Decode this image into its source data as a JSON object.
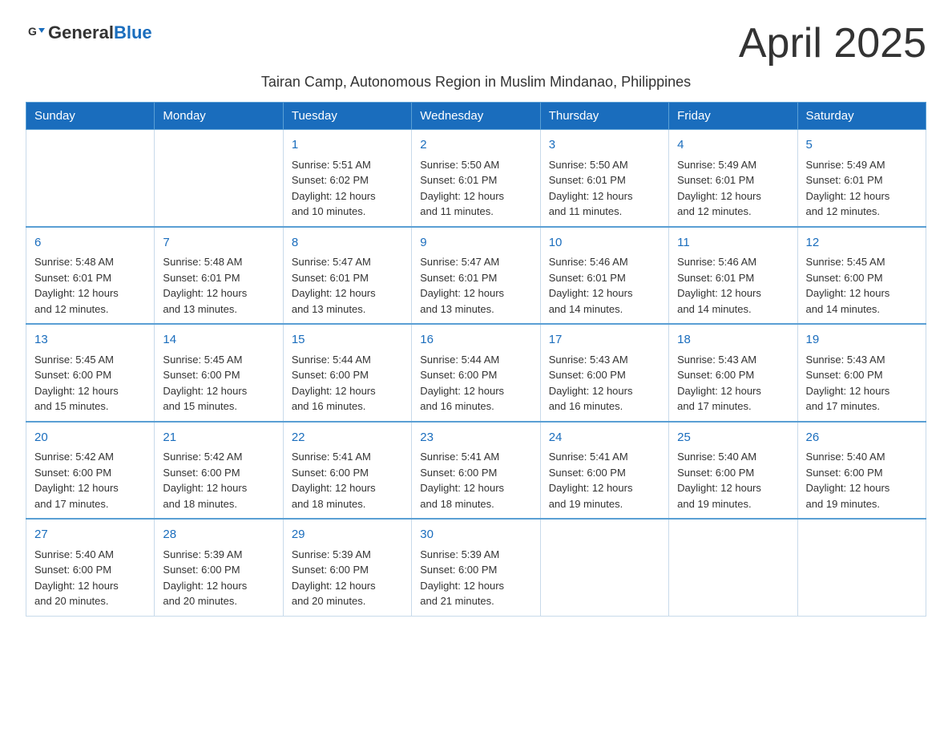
{
  "header": {
    "logo_general": "General",
    "logo_blue": "Blue",
    "title": "April 2025",
    "subtitle": "Tairan Camp, Autonomous Region in Muslim Mindanao, Philippines"
  },
  "days_of_week": [
    "Sunday",
    "Monday",
    "Tuesday",
    "Wednesday",
    "Thursday",
    "Friday",
    "Saturday"
  ],
  "weeks": [
    [
      {
        "day": "",
        "info": ""
      },
      {
        "day": "",
        "info": ""
      },
      {
        "day": "1",
        "info": "Sunrise: 5:51 AM\nSunset: 6:02 PM\nDaylight: 12 hours\nand 10 minutes."
      },
      {
        "day": "2",
        "info": "Sunrise: 5:50 AM\nSunset: 6:01 PM\nDaylight: 12 hours\nand 11 minutes."
      },
      {
        "day": "3",
        "info": "Sunrise: 5:50 AM\nSunset: 6:01 PM\nDaylight: 12 hours\nand 11 minutes."
      },
      {
        "day": "4",
        "info": "Sunrise: 5:49 AM\nSunset: 6:01 PM\nDaylight: 12 hours\nand 12 minutes."
      },
      {
        "day": "5",
        "info": "Sunrise: 5:49 AM\nSunset: 6:01 PM\nDaylight: 12 hours\nand 12 minutes."
      }
    ],
    [
      {
        "day": "6",
        "info": "Sunrise: 5:48 AM\nSunset: 6:01 PM\nDaylight: 12 hours\nand 12 minutes."
      },
      {
        "day": "7",
        "info": "Sunrise: 5:48 AM\nSunset: 6:01 PM\nDaylight: 12 hours\nand 13 minutes."
      },
      {
        "day": "8",
        "info": "Sunrise: 5:47 AM\nSunset: 6:01 PM\nDaylight: 12 hours\nand 13 minutes."
      },
      {
        "day": "9",
        "info": "Sunrise: 5:47 AM\nSunset: 6:01 PM\nDaylight: 12 hours\nand 13 minutes."
      },
      {
        "day": "10",
        "info": "Sunrise: 5:46 AM\nSunset: 6:01 PM\nDaylight: 12 hours\nand 14 minutes."
      },
      {
        "day": "11",
        "info": "Sunrise: 5:46 AM\nSunset: 6:01 PM\nDaylight: 12 hours\nand 14 minutes."
      },
      {
        "day": "12",
        "info": "Sunrise: 5:45 AM\nSunset: 6:00 PM\nDaylight: 12 hours\nand 14 minutes."
      }
    ],
    [
      {
        "day": "13",
        "info": "Sunrise: 5:45 AM\nSunset: 6:00 PM\nDaylight: 12 hours\nand 15 minutes."
      },
      {
        "day": "14",
        "info": "Sunrise: 5:45 AM\nSunset: 6:00 PM\nDaylight: 12 hours\nand 15 minutes."
      },
      {
        "day": "15",
        "info": "Sunrise: 5:44 AM\nSunset: 6:00 PM\nDaylight: 12 hours\nand 16 minutes."
      },
      {
        "day": "16",
        "info": "Sunrise: 5:44 AM\nSunset: 6:00 PM\nDaylight: 12 hours\nand 16 minutes."
      },
      {
        "day": "17",
        "info": "Sunrise: 5:43 AM\nSunset: 6:00 PM\nDaylight: 12 hours\nand 16 minutes."
      },
      {
        "day": "18",
        "info": "Sunrise: 5:43 AM\nSunset: 6:00 PM\nDaylight: 12 hours\nand 17 minutes."
      },
      {
        "day": "19",
        "info": "Sunrise: 5:43 AM\nSunset: 6:00 PM\nDaylight: 12 hours\nand 17 minutes."
      }
    ],
    [
      {
        "day": "20",
        "info": "Sunrise: 5:42 AM\nSunset: 6:00 PM\nDaylight: 12 hours\nand 17 minutes."
      },
      {
        "day": "21",
        "info": "Sunrise: 5:42 AM\nSunset: 6:00 PM\nDaylight: 12 hours\nand 18 minutes."
      },
      {
        "day": "22",
        "info": "Sunrise: 5:41 AM\nSunset: 6:00 PM\nDaylight: 12 hours\nand 18 minutes."
      },
      {
        "day": "23",
        "info": "Sunrise: 5:41 AM\nSunset: 6:00 PM\nDaylight: 12 hours\nand 18 minutes."
      },
      {
        "day": "24",
        "info": "Sunrise: 5:41 AM\nSunset: 6:00 PM\nDaylight: 12 hours\nand 19 minutes."
      },
      {
        "day": "25",
        "info": "Sunrise: 5:40 AM\nSunset: 6:00 PM\nDaylight: 12 hours\nand 19 minutes."
      },
      {
        "day": "26",
        "info": "Sunrise: 5:40 AM\nSunset: 6:00 PM\nDaylight: 12 hours\nand 19 minutes."
      }
    ],
    [
      {
        "day": "27",
        "info": "Sunrise: 5:40 AM\nSunset: 6:00 PM\nDaylight: 12 hours\nand 20 minutes."
      },
      {
        "day": "28",
        "info": "Sunrise: 5:39 AM\nSunset: 6:00 PM\nDaylight: 12 hours\nand 20 minutes."
      },
      {
        "day": "29",
        "info": "Sunrise: 5:39 AM\nSunset: 6:00 PM\nDaylight: 12 hours\nand 20 minutes."
      },
      {
        "day": "30",
        "info": "Sunrise: 5:39 AM\nSunset: 6:00 PM\nDaylight: 12 hours\nand 21 minutes."
      },
      {
        "day": "",
        "info": ""
      },
      {
        "day": "",
        "info": ""
      },
      {
        "day": "",
        "info": ""
      }
    ]
  ]
}
